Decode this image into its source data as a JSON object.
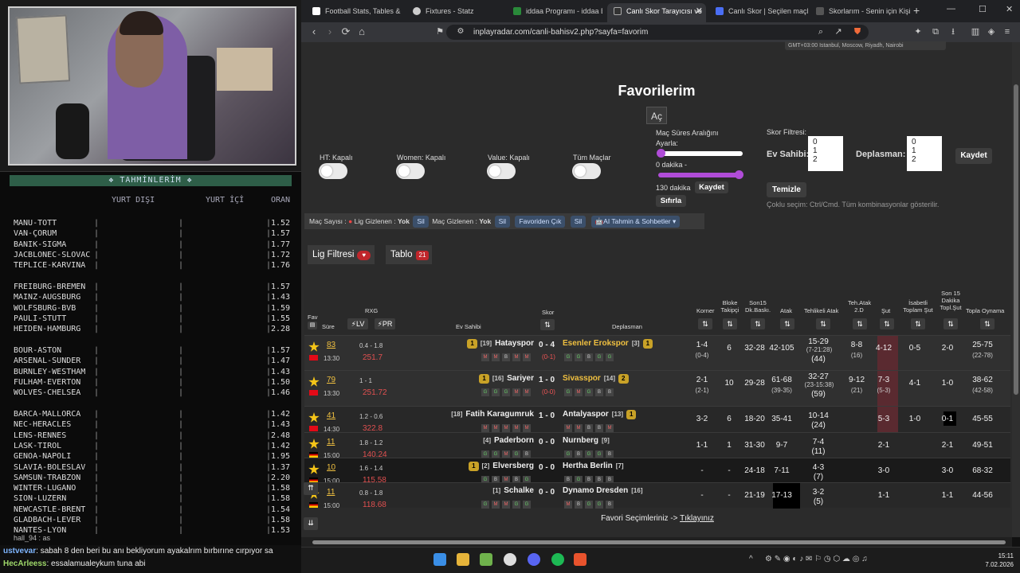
{
  "stream": {
    "predictions_title": "TAHMİNLERİM",
    "header": {
      "col1": "YURT DIŞI",
      "col2": "YURT İÇİ",
      "col3": "ORAN"
    },
    "rows": [
      {
        "match": "MANU-TOTT",
        "odd": "1.52"
      },
      {
        "match": "VAN-ÇORUM",
        "odd": "1.57"
      },
      {
        "match": "BANIK-SIGMA",
        "odd": "1.77"
      },
      {
        "match": "JACBLONEC-SLOVAC",
        "odd": "1.72"
      },
      {
        "match": "TEPLICE-KARVINA",
        "odd": "1.76"
      },
      {
        "match": "FREIBURG-BREMEN",
        "odd": "1.57"
      },
      {
        "match": "MAINZ-AUGSBURG",
        "odd": "1.43"
      },
      {
        "match": "WOLFSBURG-BVB",
        "odd": "1.59"
      },
      {
        "match": "PAULI-STUTT",
        "odd": "1.55"
      },
      {
        "match": "HEIDEN-HAMBURG",
        "odd": "2.28"
      },
      {
        "match": "BOUR-ASTON",
        "odd": "1.57"
      },
      {
        "match": "ARSENAL-SUNDER",
        "odd": "1.47"
      },
      {
        "match": "BURNLEY-WESTHAM",
        "odd": "1.43"
      },
      {
        "match": "FULHAM-EVERTON",
        "odd": "1.50"
      },
      {
        "match": "WOLVES-CHELSEA",
        "odd": "1.46"
      },
      {
        "match": "BARCA-MALLORCA",
        "odd": "1.42"
      },
      {
        "match": "NEC-HERACLES",
        "odd": "1.43"
      },
      {
        "match": "LENS-RENNES",
        "odd": "2.48"
      },
      {
        "match": "LASK-TIROL",
        "odd": "1.42"
      },
      {
        "match": "GENOA-NAPOLI",
        "odd": "1.95"
      },
      {
        "match": "SLAVIA-BOLESLAV",
        "odd": "1.37"
      },
      {
        "match": "SAMSUN-TRABZON",
        "odd": "2.20"
      },
      {
        "match": "WINTER-LUGANO",
        "odd": "1.58"
      },
      {
        "match": "SION-LUZERN",
        "odd": "1.58"
      },
      {
        "match": "NEWCASTLE-BRENT",
        "odd": "1.54"
      },
      {
        "match": "GLADBACH-LEVER",
        "odd": "1.58"
      },
      {
        "match": "NANTES-LYON",
        "odd": "1.53"
      }
    ],
    "chat": [
      {
        "user": "ustvevar",
        "msg": ": sabah 8 den beri bu anı bekliyorum ayakalrım bırbırıne cırpıyor sa"
      },
      {
        "user": "HecArleess",
        "msg": ": essalamualeykum tuna abi"
      }
    ],
    "chat_top": "hall_94 : as"
  },
  "browser": {
    "tabs": [
      "Football Stats, Tables & Da",
      "Fixtures - Statz",
      "iddaa Programı - iddaa Bu",
      "Canlı Skor Tarayıcısı ve",
      "Canlı Skor | Seçilen maçlar",
      "Skorlarım - Senin için Kişi"
    ],
    "url": "inplayradar.com/canli-bahisv2.php?sayfa=favorim",
    "timezone": "GMT+03:00 Istanbul, Moscow, Riyadh, Nairobi"
  },
  "page": {
    "title": "Favorilerim",
    "ac": "Aç",
    "toggles": [
      "HT: Kapalı",
      "Women: Kapalı",
      "Value: Kapalı",
      "Tüm Maçlar"
    ],
    "range": {
      "label1": "Maç Süres Aralığını",
      "label2": "Ayarla:",
      "min": "0 dakika -",
      "max": "130 dakika",
      "save": "Kaydet",
      "reset": "Sıfırla"
    },
    "score_filter": {
      "label": "Skor Filtresi:",
      "home": "Ev Sahibi:",
      "away": "Deplasman:",
      "options": [
        "0",
        "1",
        "2"
      ],
      "save": "Kaydet",
      "clear": "Temizle",
      "hint": "Çoklu seçim: Ctrl/Cmd. Tüm kombinasyonlar gösterilir."
    },
    "infobar": {
      "mac_sayisi": "Maç Sayısı :",
      "lig_gizlenen": "Lig Gizlenen :",
      "yok1": "Yok",
      "sil1": "Sil",
      "mac_gizlenen": "Maç Gizlenen :",
      "yok2": "Yok",
      "sil2": "Sil",
      "fav_cik": "Favoriden Çık",
      "sil3": "Sil",
      "ai": "AI Tahmin & Sohbetler"
    },
    "lig_filtresi": "Lig Filtresi",
    "tablo": "Tablo",
    "tablo_count": "21",
    "headers": {
      "fav": "Fav",
      "sure": "Süre",
      "rxg": "RXG",
      "lv": "LV",
      "pr": "PR",
      "ev": "Ev Sahibi",
      "skor": "Skor",
      "dep": "Deplasman",
      "korner": "Korner",
      "blok": "Bloke Takipçi",
      "son15": "Son15 Dk.Baskı.",
      "atak": "Atak",
      "tehatak": "Tehlikeli Atak",
      "teh2": "Teh.Atak 2.D",
      "sut": "Şut",
      "isabet": "İsabetli Toplam Şut",
      "son15s": "Son 15 Dakika Topl.Şut",
      "topla": "Topla Oynama"
    },
    "matches": [
      {
        "min": "83",
        "time": "13:30",
        "rxg": "0.4 - 1.8",
        "pr": "251.7",
        "home": "Hatayspor",
        "hrank": "[19]",
        "hbadge": "1",
        "score": "0 - 4",
        "ht": "(0-1)",
        "away": "Esenler Erokspor",
        "arank": "[3]",
        "abadge": "1",
        "corner": "1-4",
        "corner2": "(0-4)",
        "blok": "6",
        "son15": "32-28",
        "atak": "42-105",
        "tehatak": "15-29",
        "tehatak2": "(7-21:28)",
        "tehatak3": "(44)",
        "teh2": "8-8",
        "teh2b": "(16)",
        "sut": "4-12",
        "isabet": "0-5",
        "son15s": "2-0",
        "topla": "25-75",
        "topla2": "(22-78)",
        "hform": [
          "M",
          "M",
          "B",
          "M",
          "M"
        ],
        "aform": [
          "G",
          "G",
          "B",
          "G",
          "G"
        ]
      },
      {
        "min": "79",
        "time": "13:30",
        "rxg": "1 - 1",
        "pr": "251.72",
        "home": "Sariyer",
        "hrank": "[16]",
        "hbadge": "1",
        "score": "1 - 0",
        "ht": "(0-0)",
        "away": "Sivasspor",
        "arank": "[14]",
        "abadge": "2",
        "corner": "2-1",
        "corner2": "(2-1)",
        "blok": "10",
        "son15": "29-28",
        "atak": "61-68",
        "atak2": "(39-35)",
        "tehatak": "32-27",
        "tehatak2": "(23-15:38)",
        "tehatak3": "(59)",
        "teh2": "9-12",
        "teh2b": "(21)",
        "sut": "7-3",
        "sut2": "(5-3)",
        "isabet": "4-1",
        "son15s": "1-0",
        "topla": "38-62",
        "topla2": "(42-58)",
        "hform": [
          "G",
          "G",
          "G",
          "M",
          "M"
        ],
        "aform": [
          "G",
          "M",
          "G",
          "B",
          "B"
        ]
      },
      {
        "min": "41",
        "time": "14:30",
        "rxg": "1.2 - 0.6",
        "pr": "322.8",
        "home": "Fatih Karagumruk",
        "hrank": "[18]",
        "score": "1 - 0",
        "away": "Antalyaspor",
        "arank": "[13]",
        "abadge": "1",
        "corner": "3-2",
        "blok": "6",
        "son15": "18-20",
        "atak": "35-41",
        "tehatak": "10-14",
        "tehatak3": "(24)",
        "sut": "5-3",
        "isabet": "1-0",
        "son15s": "0-1",
        "topla": "45-55",
        "hform": [
          "M",
          "M",
          "M",
          "M",
          "M"
        ],
        "aform": [
          "M",
          "M",
          "B",
          "B",
          "M"
        ]
      },
      {
        "min": "11",
        "time": "15:00",
        "rxg": "1.8 - 1.2",
        "pr": "140.24",
        "home": "Paderborn",
        "hrank": "[4]",
        "score": "0 - 0",
        "away": "Nurnberg",
        "arank": "[9]",
        "corner": "1-1",
        "blok": "1",
        "son15": "31-30",
        "atak": "9-7",
        "tehatak": "7-4",
        "tehatak3": "(11)",
        "sut": "2-1",
        "son15s": "2-1",
        "topla": "49-51",
        "hform": [
          "G",
          "G",
          "M",
          "G",
          "B"
        ],
        "aform": [
          "G",
          "B",
          "G",
          "G",
          "B"
        ]
      },
      {
        "min": "10",
        "time": "15:00",
        "rxg": "1.6 - 1.4",
        "pr": "115.58",
        "home": "Elversberg",
        "hrank": "[2]",
        "hbadge": "1",
        "score": "0 - 0",
        "away": "Hertha Berlin",
        "arank": "[7]",
        "corner": "-",
        "blok": "-",
        "son15": "24-18",
        "atak": "7-11",
        "tehatak": "4-3",
        "tehatak3": "(7)",
        "sut": "3-0",
        "son15s": "3-0",
        "topla": "68-32",
        "hform": [
          "G",
          "B",
          "M",
          "B",
          "G"
        ],
        "aform": [
          "B",
          "G",
          "B",
          "B",
          "B"
        ]
      },
      {
        "min": "11",
        "time": "15:00",
        "rxg": "0.8 - 1.8",
        "pr": "118.68",
        "home": "Schalke",
        "hrank": "[1]",
        "score": "0 - 0",
        "away": "Dynamo Dresden",
        "arank": "[16]",
        "corner": "-",
        "blok": "-",
        "son15": "21-19",
        "atak": "17-13",
        "tehatak": "3-2",
        "tehatak3": "(5)",
        "sut": "1-1",
        "son15s": "1-1",
        "topla": "44-56",
        "hform": [
          "G",
          "M",
          "M",
          "G",
          "G"
        ],
        "aform": [
          "M",
          "B",
          "G",
          "G",
          "B"
        ]
      }
    ],
    "fav_footer": "Favori Seçimleriniz ->",
    "fav_link": "Tıklayınız"
  },
  "taskbar": {
    "time": "15:11",
    "date": "7.02.2026"
  }
}
